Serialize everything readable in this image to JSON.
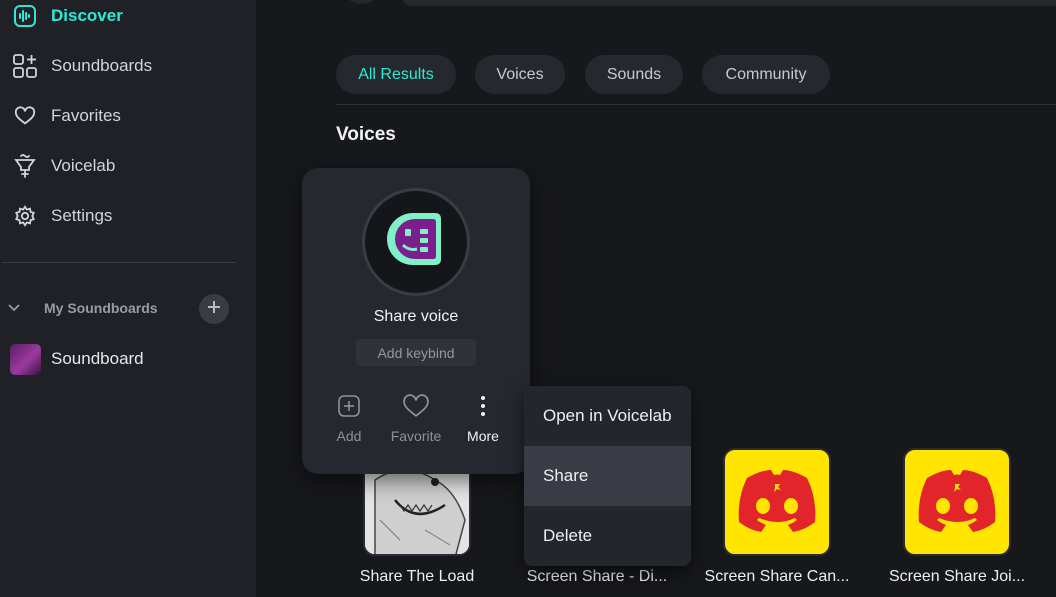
{
  "sidebar": {
    "items": [
      {
        "label": "Discover",
        "icon": "waveform-icon",
        "active": true
      },
      {
        "label": "Soundboards",
        "icon": "grid-plus-icon"
      },
      {
        "label": "Favorites",
        "icon": "heart-icon"
      },
      {
        "label": "Voicelab",
        "icon": "funnel-icon"
      },
      {
        "label": "Settings",
        "icon": "gear-icon"
      }
    ],
    "my_soundboards_label": "My Soundboards",
    "soundboards": [
      {
        "label": "Soundboard"
      }
    ]
  },
  "tabs": [
    {
      "label": "All Results",
      "active": true
    },
    {
      "label": "Voices"
    },
    {
      "label": "Sounds"
    },
    {
      "label": "Community"
    }
  ],
  "section_title": "Voices",
  "voice_card": {
    "title": "Share voice",
    "keybind_placeholder": "Add keybind",
    "actions": {
      "add": "Add",
      "favorite": "Favorite",
      "more": "More"
    }
  },
  "context_menu": {
    "items": [
      "Open in Voicelab",
      "Share",
      "Delete"
    ],
    "highlighted": "Share"
  },
  "sounds": [
    {
      "name": "Share The Load"
    },
    {
      "name": "Screen Share - Di..."
    },
    {
      "name": "Screen Share Can..."
    },
    {
      "name": "Screen Share Joi..."
    }
  ],
  "colors": {
    "accent": "#2ee8d6",
    "sidebar_bg": "#1f2127",
    "main_bg": "#17181c",
    "discord_red": "#e2252b",
    "discord_yellow": "#ffe500",
    "voice_logo_green": "#7ff0c8",
    "voice_logo_purple": "#7a1f8c"
  }
}
